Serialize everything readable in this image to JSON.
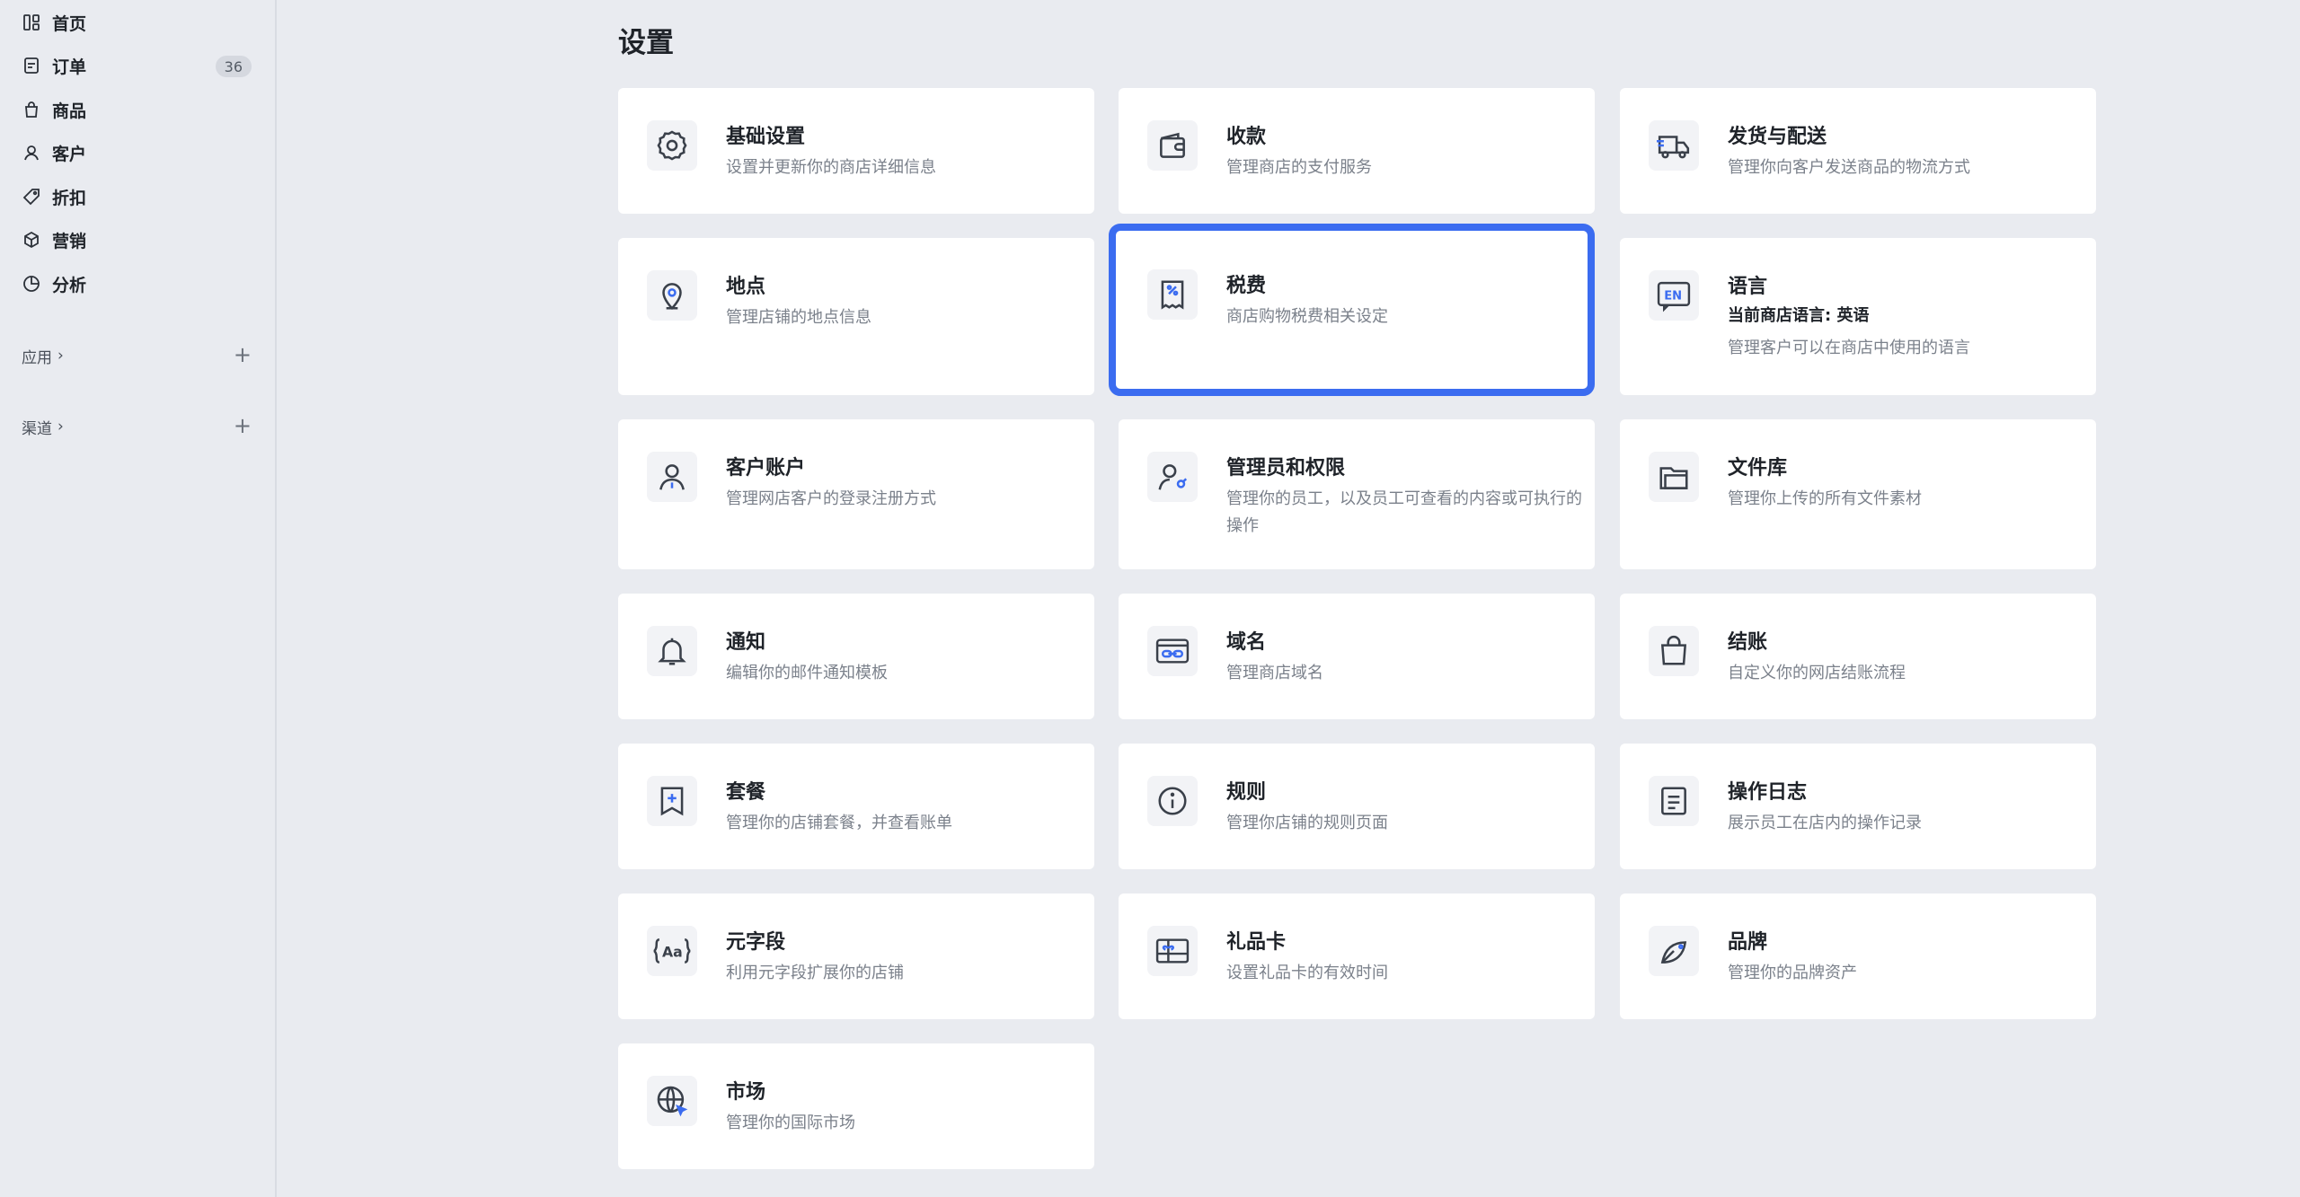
{
  "sidebar": {
    "nav": [
      {
        "label": "首页",
        "icon": "home-dashboard-icon"
      },
      {
        "label": "订单",
        "icon": "orders-icon",
        "badge": "36"
      },
      {
        "label": "商品",
        "icon": "bag-icon"
      },
      {
        "label": "客户",
        "icon": "person-icon"
      },
      {
        "label": "折扣",
        "icon": "tag-icon"
      },
      {
        "label": "营销",
        "icon": "cube-icon"
      },
      {
        "label": "分析",
        "icon": "pie-chart-icon"
      }
    ],
    "sections": [
      {
        "label": "应用",
        "chevron": "›"
      },
      {
        "label": "渠道",
        "chevron": "›"
      }
    ],
    "plus": "+"
  },
  "main": {
    "title": "设置",
    "selected_card": "税费",
    "accent_color": "#3b6cf0",
    "cards": [
      {
        "title": "基础设置",
        "desc": "设置并更新你的商店详细信息",
        "icon": "gear-icon"
      },
      {
        "title": "收款",
        "desc": "管理商店的支付服务",
        "icon": "wallet-icon"
      },
      {
        "title": "发货与配送",
        "desc": "管理你向客户发送商品的物流方式",
        "icon": "truck-icon"
      },
      {
        "title": "地点",
        "desc": "管理店铺的地点信息",
        "icon": "location-pin-icon"
      },
      {
        "title": "税费",
        "desc": "商店购物税费相关设定",
        "icon": "tax-receipt-icon"
      },
      {
        "title": "语言",
        "extra": "当前商店语言: 英语",
        "desc": "管理客户可以在商店中使用的语言",
        "icon": "language-en-icon"
      },
      {
        "title": "客户账户",
        "desc": "管理网店客户的登录注册方式",
        "icon": "customer-account-icon"
      },
      {
        "title": "管理员和权限",
        "desc": "管理你的员工，以及员工可查看的内容或可执行的操作",
        "icon": "admin-permission-icon"
      },
      {
        "title": "文件库",
        "desc": "管理你上传的所有文件素材",
        "icon": "folder-icon"
      },
      {
        "title": "通知",
        "desc": "编辑你的邮件通知模板",
        "icon": "bell-icon"
      },
      {
        "title": "域名",
        "desc": "管理商店域名",
        "icon": "domain-link-icon"
      },
      {
        "title": "结账",
        "desc": "自定义你的网店结账流程",
        "icon": "checkout-bag-icon"
      },
      {
        "title": "套餐",
        "desc": "管理你的店铺套餐，并查看账单",
        "icon": "plan-icon"
      },
      {
        "title": "规则",
        "desc": "管理你店铺的规则页面",
        "icon": "info-icon"
      },
      {
        "title": "操作日志",
        "desc": "展示员工在店内的操作记录",
        "icon": "log-document-icon"
      },
      {
        "title": "元字段",
        "desc": "利用元字段扩展你的店铺",
        "icon": "metafield-braces-icon"
      },
      {
        "title": "礼品卡",
        "desc": "设置礼品卡的有效时间",
        "icon": "gift-card-icon"
      },
      {
        "title": "品牌",
        "desc": "管理你的品牌资产",
        "icon": "brand-leaf-icon"
      },
      {
        "title": "市场",
        "desc": "管理你的国际市场",
        "icon": "globe-market-icon"
      }
    ]
  }
}
